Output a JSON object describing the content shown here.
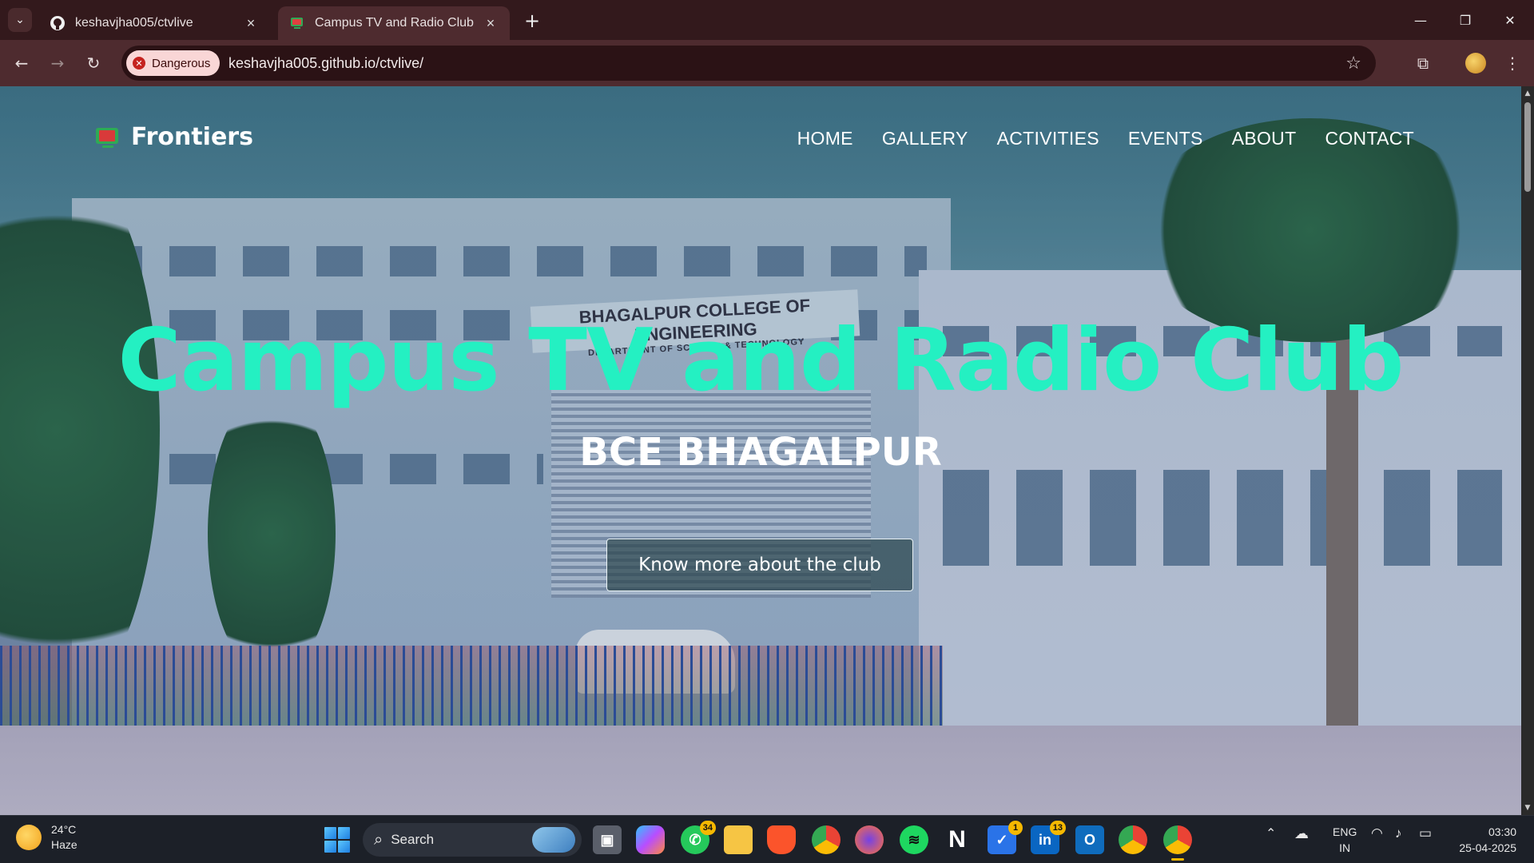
{
  "browser": {
    "tabs": [
      {
        "title": "keshavjha005/ctvlive",
        "icon": "github-icon",
        "active": false
      },
      {
        "title": "Campus TV and Radio Club",
        "icon": "tv-icon",
        "active": true
      }
    ],
    "security_label": "Dangerous",
    "url": "keshavjha005.github.io/ctvlive/"
  },
  "site": {
    "logo_text": "Frontiers",
    "nav": [
      "HOME",
      "GALLERY",
      "ACTIVITIES",
      "EVENTS",
      "ABOUT",
      "CONTACT"
    ],
    "hero_title": "Campus TV and Radio Club",
    "hero_subtitle": "BCE BHAGALPUR",
    "cta_label": "Know more about the club",
    "background_sign": {
      "line1": "BHAGALPUR COLLEGE OF ENGINEERING",
      "line2": "DEPARTMENT OF SCIENCE & TECHNOLOGY"
    },
    "accent_color": "#24f0c2"
  },
  "taskbar": {
    "weather": {
      "temp": "24°C",
      "condition": "Haze"
    },
    "search_label": "Search",
    "apps": [
      {
        "name": "task-view"
      },
      {
        "name": "copilot"
      },
      {
        "name": "whatsapp",
        "badge": "34"
      },
      {
        "name": "file-explorer"
      },
      {
        "name": "brave"
      },
      {
        "name": "chrome"
      },
      {
        "name": "firefox"
      },
      {
        "name": "spotify"
      },
      {
        "name": "notion"
      },
      {
        "name": "todo",
        "badge": "1"
      },
      {
        "name": "linkedin",
        "badge": "13"
      },
      {
        "name": "outlook"
      },
      {
        "name": "chrome-profile"
      },
      {
        "name": "chrome-active"
      }
    ],
    "tray": {
      "lang1": "ENG",
      "lang2": "IN"
    },
    "clock": {
      "time": "03:30",
      "date": "25-04-2025"
    }
  }
}
